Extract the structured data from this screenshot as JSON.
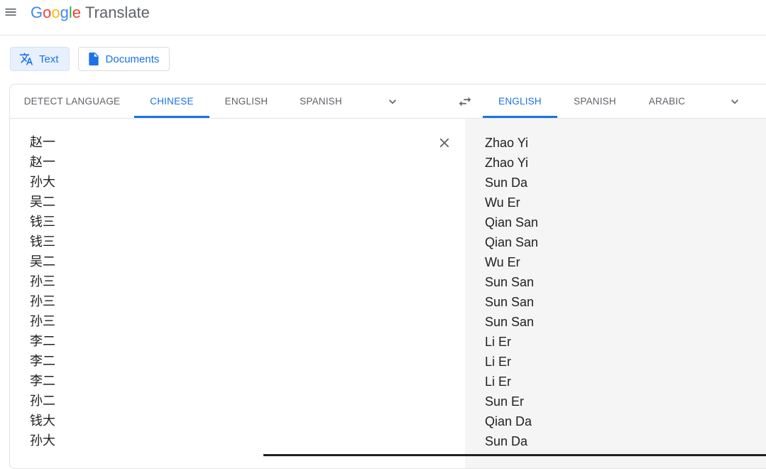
{
  "header": {
    "logo_letters": [
      {
        "char": "G",
        "color": "#4285f4"
      },
      {
        "char": "o",
        "color": "#ea4335"
      },
      {
        "char": "o",
        "color": "#fbbc05"
      },
      {
        "char": "g",
        "color": "#4285f4"
      },
      {
        "char": "l",
        "color": "#34a853"
      },
      {
        "char": "e",
        "color": "#ea4335"
      }
    ],
    "product_name": "Translate",
    "menu_icon": "hamburger-menu-icon"
  },
  "modes": {
    "text_label": "Text",
    "text_icon": "translate-icon",
    "documents_label": "Documents",
    "documents_icon": "document-icon",
    "active": "text"
  },
  "source_languages": {
    "tabs": [
      "DETECT LANGUAGE",
      "CHINESE",
      "ENGLISH",
      "SPANISH"
    ],
    "active": "CHINESE"
  },
  "target_languages": {
    "tabs": [
      "ENGLISH",
      "SPANISH",
      "ARABIC"
    ],
    "active": "ENGLISH"
  },
  "source_text_lines": [
    "赵一",
    "赵一",
    "孙大",
    "吴二",
    "钱三",
    "钱三",
    "吴二",
    "孙三",
    "孙三",
    "孙三",
    "李二",
    "李二",
    "李二",
    "孙二",
    "钱大",
    "孙大"
  ],
  "translated_lines": [
    "Zhao Yi",
    "Zhao Yi",
    "Sun Da",
    "Wu Er",
    "Qian San",
    "Qian San",
    "Wu Er",
    "Sun San",
    "Sun San",
    "Sun San",
    "Li Er",
    "Li Er",
    "Li Er",
    "Sun Er",
    "Qian Da",
    "Sun Da"
  ],
  "colors": {
    "accent": "#1a73e8",
    "text": "#202124",
    "muted": "#5f6368",
    "target_bg": "#f5f5f5"
  }
}
